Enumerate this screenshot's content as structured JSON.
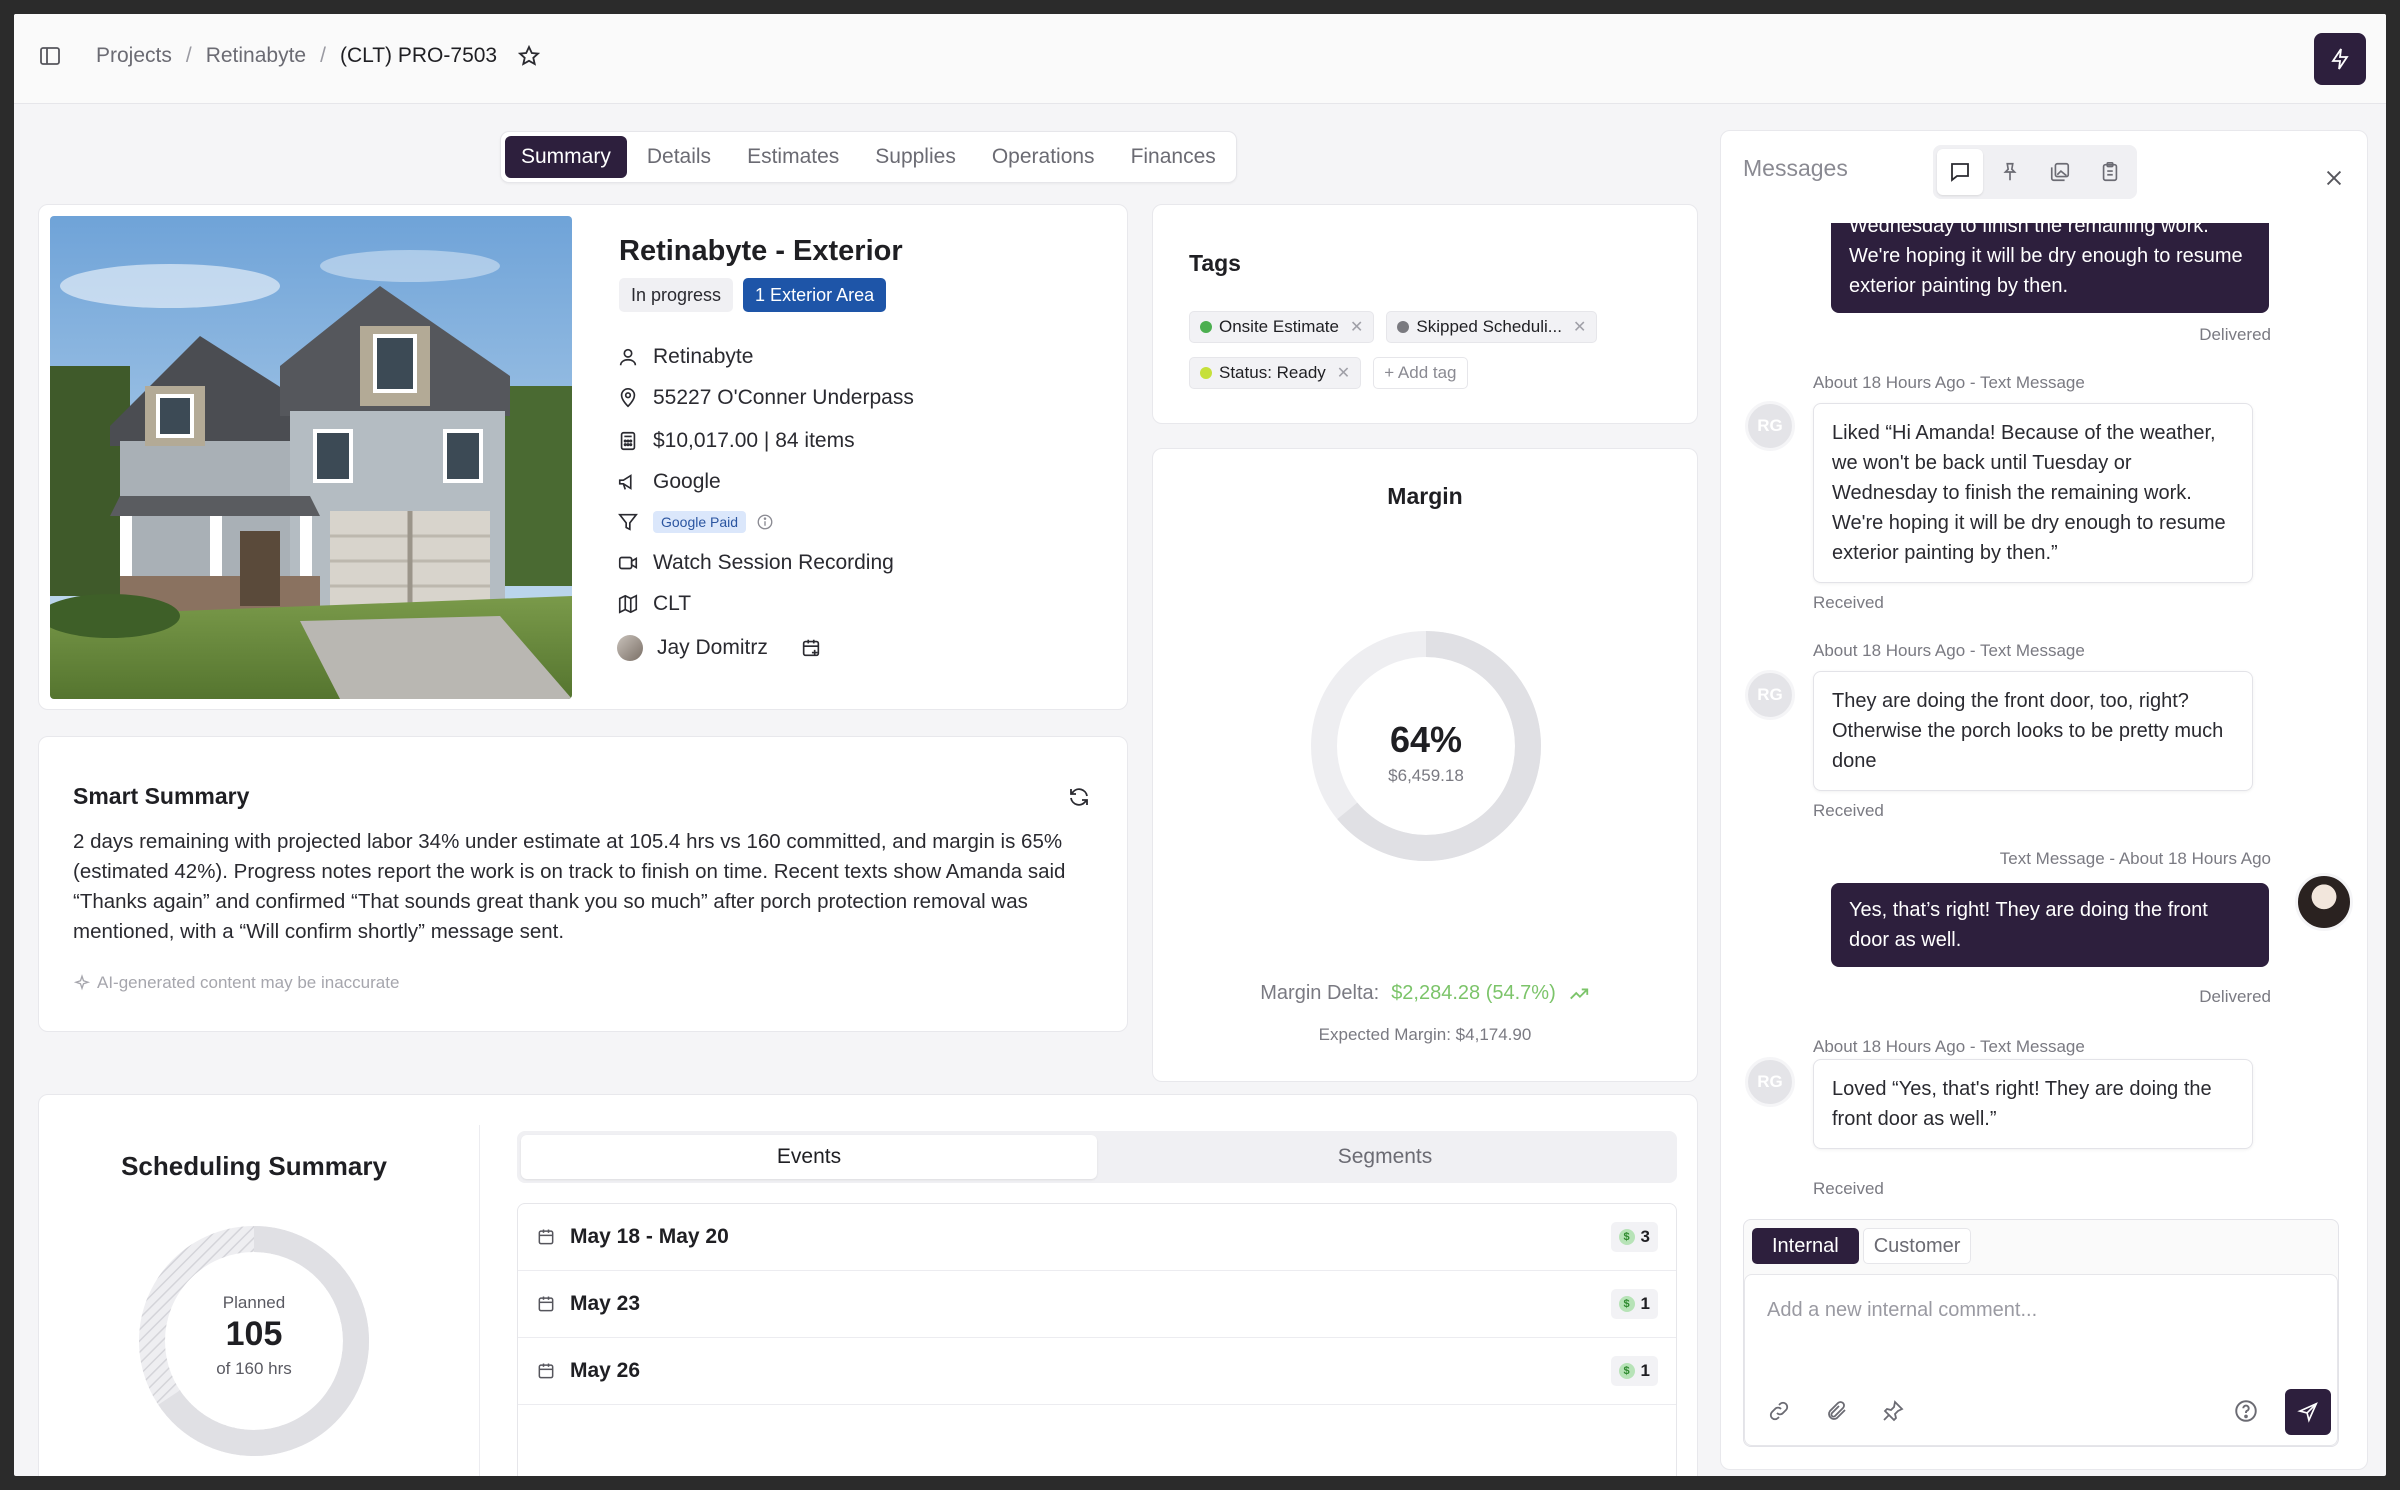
{
  "breadcrumb": {
    "items": [
      "Projects",
      "Retinabyte",
      "(CLT) PRO-7503"
    ]
  },
  "tabs": [
    "Summary",
    "Details",
    "Estimates",
    "Supplies",
    "Operations",
    "Finances"
  ],
  "project": {
    "title": "Retinabyte - Exterior",
    "status": "In progress",
    "area": "1 Exterior Area",
    "client": "Retinabyte",
    "address": "55227 O'Conner Underpass",
    "estimate": "$10,017.00 | 84 items",
    "source": "Google",
    "source_tag": "Google Paid",
    "recording": "Watch Session Recording",
    "region": "CLT",
    "assignee": "Jay Domitrz"
  },
  "smart_summary": {
    "title": "Smart Summary",
    "text": "2 days remaining with projected labor 34% under estimate at 105.4 hrs vs 160 committed, and margin is 65% (estimated 42%). Progress notes report the work is on track to finish on time. Recent texts show Amanda said “Thanks again” and confirmed “That sounds great thank you so much” after porch protection removal was mentioned, with a “Will confirm shortly” message sent.",
    "disclaimer": "AI-generated content may be inaccurate"
  },
  "tags": {
    "title": "Tags",
    "items": [
      {
        "label": "Onsite Estimate",
        "color": "#4caf50"
      },
      {
        "label": "Skipped Scheduli...",
        "color": "#7a7a80"
      },
      {
        "label": "Status: Ready",
        "color": "#c6e03a"
      }
    ],
    "add_label": "+ Add tag"
  },
  "margin": {
    "title": "Margin",
    "percent_label": "64%",
    "percent": 0.64,
    "amount": "$6,459.18",
    "delta_label": "Margin Delta:",
    "delta_value": "$2,284.28 (54.7%)",
    "expected": "Expected Margin: $4,174.90"
  },
  "scheduling": {
    "title": "Scheduling Summary",
    "planned_label": "Planned",
    "planned_value": "105",
    "planned_of": "of 160 hrs",
    "tabs": [
      "Events",
      "Segments"
    ],
    "events": [
      {
        "label": "May 18 - May 20",
        "count": "3"
      },
      {
        "label": "May 23",
        "count": "1"
      },
      {
        "label": "May 26",
        "count": "1"
      }
    ]
  },
  "messages": {
    "title": "Messages",
    "m0_text": "Wednesday to finish the remaining work. We're hoping it will be dry enough to resume exterior painting by then.",
    "m0_status": "Delivered",
    "m1_meta": "About 18 Hours Ago - Text Message",
    "m1_text": "Liked “Hi Amanda! Because of the weather, we won't be back until Tuesday or Wednesday to finish the remaining work. We're hoping it will be dry enough to resume exterior painting by then.”",
    "m1_status": "Received",
    "m2_meta": "About 18 Hours Ago - Text Message",
    "m2_text": "They are doing the front door, too, right? Otherwise the porch looks to be pretty much done",
    "m2_status": "Received",
    "m3_meta": "Text Message - About 18 Hours Ago",
    "m3_text": "Yes, that’s right! They are doing the front door as well.",
    "m3_status": "Delivered",
    "m4_meta": "About 18 Hours Ago - Text Message",
    "m4_text": "Loved “Yes, that's right! They are doing the front door as well.”",
    "m4_status": "Received",
    "sender_initials": "RG",
    "composer_tabs": [
      "Internal",
      "Customer"
    ],
    "composer_placeholder": "Add a new internal comment..."
  }
}
